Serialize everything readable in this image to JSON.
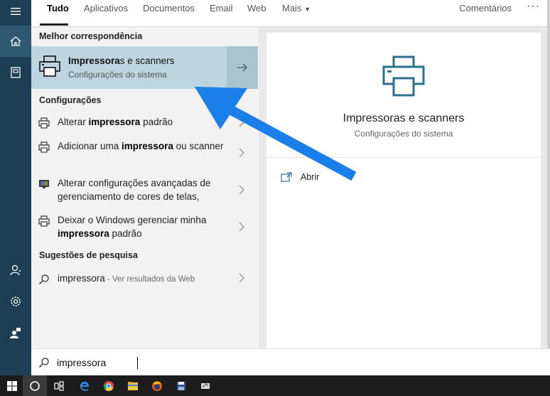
{
  "tabs": {
    "items": [
      {
        "label": "Tudo"
      },
      {
        "label": "Aplicativos"
      },
      {
        "label": "Documentos"
      },
      {
        "label": "Email"
      },
      {
        "label": "Web"
      },
      {
        "label": "Mais"
      }
    ],
    "active": "Tudo",
    "feedback": "Comentários",
    "more": "···"
  },
  "results": {
    "best_match_heading": "Melhor correspondência",
    "best_match": {
      "title_bold": "Impressora",
      "title_rest": "s e scanners",
      "subtitle": "Configurações do sistema"
    },
    "settings_heading": "Configurações",
    "settings_items": [
      {
        "before": "Alterar ",
        "bold": "impressora",
        "after": " padrão",
        "icon": "printer-icon"
      },
      {
        "before": "Adicionar uma ",
        "bold": "impressora",
        "after": " ou scanner",
        "icon": "printer-icon"
      },
      {
        "before": "Alterar configurações avançadas de gerenciamento de cores de telas,",
        "bold": "",
        "after": "",
        "icon": "monitor-color-icon"
      },
      {
        "before": "Deixar o Windows gerenciar minha ",
        "bold": "impressora",
        "after": " padrão",
        "icon": "printer-icon"
      }
    ],
    "suggestions_heading": "Sugestões de pesquisa",
    "suggestion": {
      "query": "impressora",
      "hint": " - Ver resultados da Web"
    }
  },
  "preview": {
    "title": "Impressoras e scanners",
    "subtitle": "Configurações do sistema",
    "open_label": "Abrir"
  },
  "search": {
    "value": "impressora"
  },
  "colors": {
    "rail": "#1e3f53",
    "best_match_bg": "#bcd5e0",
    "accent_icon": "#2e6f8e",
    "annotation_arrow": "#1a7fe8"
  }
}
